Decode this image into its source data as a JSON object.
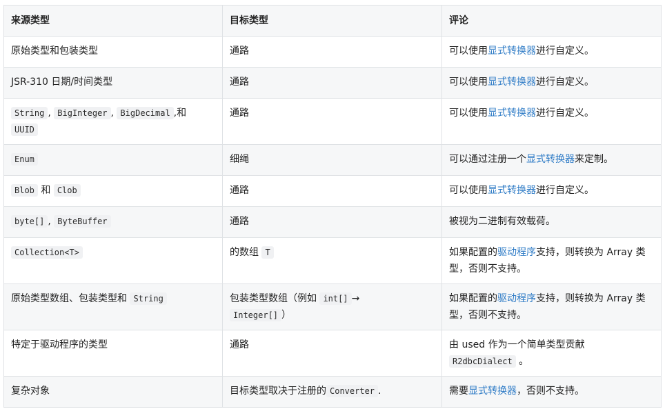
{
  "headers": [
    "来源类型",
    "目标类型",
    "评论"
  ],
  "link_text": "显式转换器",
  "rows": [
    {
      "source": {
        "t1": "原始类型和包装类型"
      },
      "target": {
        "t1": "通路"
      },
      "comment": {
        "pre": "可以使用",
        "link": "显式转换器",
        "post": "进行自定义。"
      }
    },
    {
      "source": {
        "t1": "JSR-310 日期/时间类型"
      },
      "target": {
        "t1": "通路"
      },
      "comment": {
        "pre": "可以使用",
        "link": "显式转换器",
        "post": "进行自定义。"
      }
    },
    {
      "source": {
        "c1": "String",
        "sep1": ",",
        "c2": "BigInteger",
        "sep2": ",",
        "c3": "BigDecimal",
        "sep3": ",和",
        "c4": "UUID"
      },
      "target": {
        "t1": "通路"
      },
      "comment": {
        "pre": "可以使用",
        "link": "显式转换器",
        "post": "进行自定义。"
      }
    },
    {
      "source": {
        "c1": "Enum"
      },
      "target": {
        "t1": "细绳"
      },
      "comment": {
        "pre": "可以通过注册一个",
        "link": "显式转换器",
        "post": "来定制。"
      }
    },
    {
      "source": {
        "c1": "Blob",
        "sep1": "和",
        "c2": "Clob"
      },
      "target": {
        "t1": "通路"
      },
      "comment": {
        "pre": "可以使用",
        "link": "显式转换器",
        "post": "进行自定义。"
      }
    },
    {
      "source": {
        "c1": "byte[]",
        "sep1": ",",
        "c2": "ByteBuffer"
      },
      "target": {
        "t1": "通路"
      },
      "comment": {
        "pre": "被视为二进制有效载荷。"
      }
    },
    {
      "source": {
        "c1": "Collection<T>"
      },
      "target": {
        "t1": "的数组",
        "c1": "T"
      },
      "comment": {
        "pre": "如果配置的",
        "link": "驱动程序",
        "post": "支持，则转换为 Array 类型，否则不支持。"
      }
    },
    {
      "source": {
        "t1": "原始类型数组、包装类型和",
        "c1": "String"
      },
      "target": {
        "t1": "包装类型数组（例如",
        "c1": "int[]",
        "t2": "→",
        "c2": "Integer[]",
        "t3": "）"
      },
      "comment": {
        "pre": "如果配置的",
        "link": "驱动程序",
        "post": "支持，则转换为 Array 类型，否则不支持。"
      }
    },
    {
      "source": {
        "t1": "特定于驱动程序的类型"
      },
      "target": {
        "t1": "通路"
      },
      "comment": {
        "pre": "由 used 作为一个简单类型贡献",
        "code": "R2dbcDialect",
        "post": "。"
      }
    },
    {
      "source": {
        "t1": "复杂对象"
      },
      "target": {
        "t1": "目标类型取决于注册的",
        "c1": "Converter",
        "t2": "."
      },
      "comment": {
        "pre": "需要",
        "link": "显式转换器",
        "post": "，否则不支持。"
      }
    }
  ]
}
